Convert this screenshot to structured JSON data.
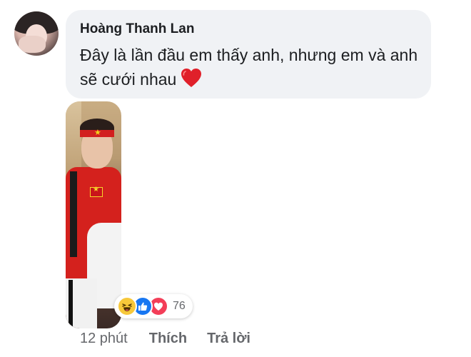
{
  "comment": {
    "author": "Hoàng Thanh Lan",
    "text": "Đây là lần đầu em thấy anh, nhưng em và anh sẽ cưới nhau",
    "emoji": "red-heart"
  },
  "reactions": {
    "types": [
      "haha-icon",
      "like-icon",
      "love-icon"
    ],
    "count": "76"
  },
  "actions": {
    "time": "12 phút",
    "like_label": "Thích",
    "reply_label": "Trả lời"
  },
  "colors": {
    "bubble_bg": "#f0f2f5",
    "like_blue": "#1877f2",
    "love_red": "#f33e58",
    "haha_yellow": "#f7c83a",
    "meta_gray": "#65676b"
  }
}
